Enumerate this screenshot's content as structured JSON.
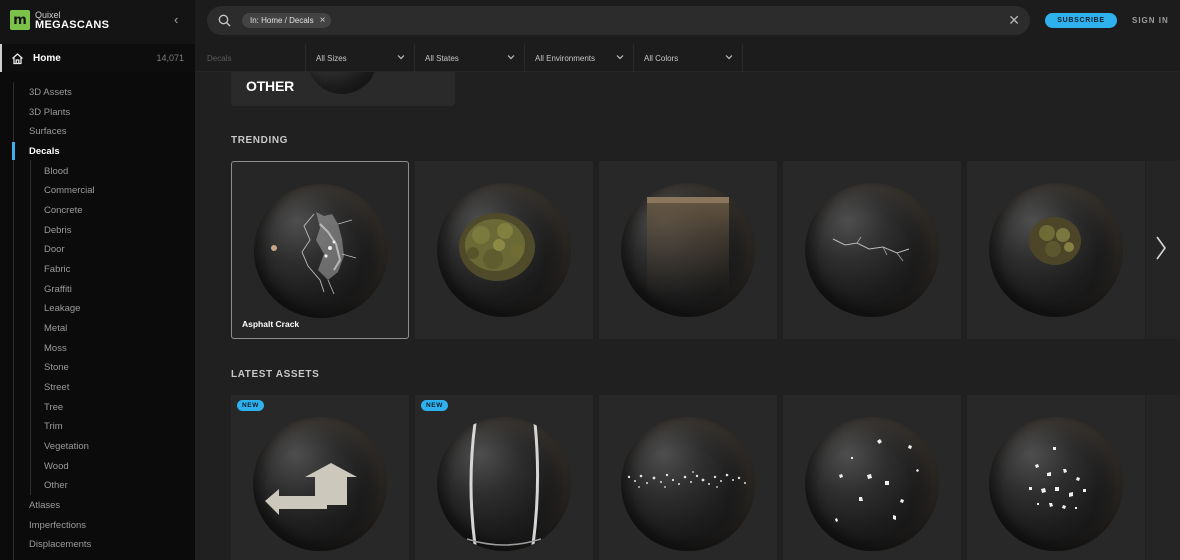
{
  "brand": {
    "small": "Quixel",
    "big": "MEGASCANS",
    "logo_letter": "m",
    "logo_color": "#7cc24a"
  },
  "sidebar": {
    "home": {
      "label": "Home",
      "count": "14,071"
    },
    "categories": [
      {
        "label": "3D Assets"
      },
      {
        "label": "3D Plants"
      },
      {
        "label": "Surfaces"
      },
      {
        "label": "Decals",
        "active": true
      }
    ],
    "decal_subcategories": [
      "Blood",
      "Commercial",
      "Concrete",
      "Debris",
      "Door",
      "Fabric",
      "Graffiti",
      "Leakage",
      "Metal",
      "Moss",
      "Stone",
      "Street",
      "Tree",
      "Trim",
      "Vegetation",
      "Wood",
      "Other"
    ],
    "more_categories": [
      "Atlases",
      "Imperfections",
      "Displacements"
    ]
  },
  "search": {
    "chip_label": "In: Home / Decals"
  },
  "header": {
    "subscribe": "SUBSCRIBE",
    "signin": "SIGN IN",
    "accent": "#2fb1ee"
  },
  "filters": [
    {
      "label": "Decals"
    },
    {
      "label": "All Sizes"
    },
    {
      "label": "All States"
    },
    {
      "label": "All Environments"
    },
    {
      "label": "All Colors"
    }
  ],
  "other_card": {
    "label": "OTHER"
  },
  "trending": {
    "title": "TRENDING",
    "items": [
      {
        "label": "Asphalt Crack",
        "selected": true,
        "kind": "crack-dust"
      },
      {
        "label": "",
        "kind": "moss"
      },
      {
        "label": "",
        "kind": "leak"
      },
      {
        "label": "",
        "kind": "crack"
      },
      {
        "label": "",
        "kind": "moss-small"
      }
    ]
  },
  "latest": {
    "title": "LATEST ASSETS",
    "items": [
      {
        "badge": "NEW",
        "kind": "arrow-marking"
      },
      {
        "badge": "NEW",
        "kind": "lines"
      },
      {
        "badge": "",
        "kind": "speckle-band"
      },
      {
        "badge": "",
        "kind": "chips"
      },
      {
        "badge": "",
        "kind": "chips-dense"
      }
    ]
  }
}
